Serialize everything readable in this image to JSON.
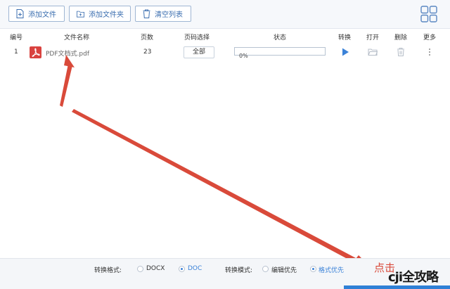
{
  "toolbar": {
    "add_file_label": "添加文件",
    "add_folder_label": "添加文件夹",
    "clear_list_label": "清空列表"
  },
  "table": {
    "headers": {
      "index": "编号",
      "filename": "文件名称",
      "pages": "页数",
      "page_select": "页码选择",
      "status": "状态",
      "convert": "转换",
      "open": "打开",
      "delete": "删除",
      "more": "更多"
    },
    "rows": [
      {
        "index": "1",
        "filename": "PDF文档式.pdf",
        "pages": "23",
        "page_select": "全部",
        "progress_text": "0%",
        "progress_fraction": 0.0
      }
    ]
  },
  "bottom": {
    "format_label": "转换格式:",
    "format_options": [
      "DOCX",
      "DOC"
    ],
    "format_selected": "DOC",
    "mode_label": "转换模式:",
    "mode_options": [
      "编辑优先",
      "格式优先"
    ],
    "mode_selected": "格式优先"
  },
  "annotation": {
    "click_text": "点击"
  },
  "watermark": {
    "text": "cji全攻略"
  },
  "colors": {
    "accent": "#3b82d8",
    "arrow": "#d94a3a",
    "pdf_red": "#d9423f",
    "button_border": "#9fb6d3"
  }
}
